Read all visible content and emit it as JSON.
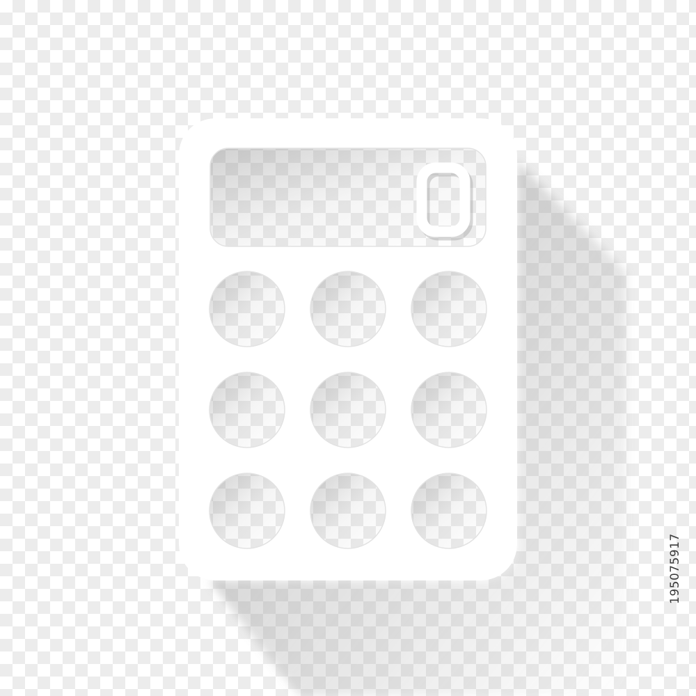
{
  "icon": {
    "name": "calculator-icon",
    "display_digit": "0",
    "fill_color": "#ffffff",
    "shadow_color": "#9a9a9a",
    "key_count": 9
  },
  "background": {
    "pattern": "transparency-checkerboard",
    "light": "#ffffff",
    "dark": "#ececec"
  },
  "stock_id": "195075917"
}
